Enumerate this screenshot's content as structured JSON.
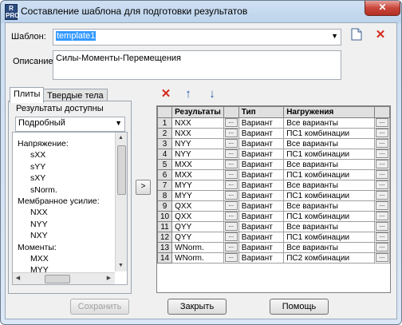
{
  "window": {
    "app_icon_text": "R PRO",
    "title": "Составление шаблона для подготовки результатов",
    "close_glyph": "✕"
  },
  "template": {
    "label": "Шаблон:",
    "value": "template1"
  },
  "description": {
    "label": "Описание:",
    "value": "Силы-Моменты-Перемещения"
  },
  "tabs": [
    {
      "label": "Плиты"
    },
    {
      "label": "Твердые тела"
    }
  ],
  "left_panel": {
    "available_label": "Результаты доступны",
    "detail_mode": "Подробный",
    "tree": [
      {
        "text": "Напряжение:",
        "level": 0
      },
      {
        "text": "sXX",
        "level": 1
      },
      {
        "text": "sYY",
        "level": 1
      },
      {
        "text": "sXY",
        "level": 1
      },
      {
        "text": "sNorm.",
        "level": 1
      },
      {
        "text": "Мембранное усилие:",
        "level": 0
      },
      {
        "text": "NXX",
        "level": 1
      },
      {
        "text": "NYY",
        "level": 1
      },
      {
        "text": "NXY",
        "level": 1
      },
      {
        "text": "Моменты:",
        "level": 0
      },
      {
        "text": "MXX",
        "level": 1
      },
      {
        "text": "MYY",
        "level": 1
      }
    ]
  },
  "move_button": ">",
  "toolbar": {
    "delete_glyph": "✕",
    "up_glyph": "↑",
    "down_glyph": "↓"
  },
  "grid": {
    "headers": [
      "",
      "Результаты",
      "",
      "Тип",
      "Нагружения",
      ""
    ],
    "dot_glyph": "...",
    "rows": [
      {
        "n": "1",
        "result": "NXX",
        "type": "Вариант",
        "load": "Все варианты"
      },
      {
        "n": "2",
        "result": "NXX",
        "type": "Вариант",
        "load": "ПС1 комбинации"
      },
      {
        "n": "3",
        "result": "NYY",
        "type": "Вариант",
        "load": "Все варианты"
      },
      {
        "n": "4",
        "result": "NYY",
        "type": "Вариант",
        "load": "ПС1 комбинации"
      },
      {
        "n": "5",
        "result": "MXX",
        "type": "Вариант",
        "load": "Все варианты"
      },
      {
        "n": "6",
        "result": "MXX",
        "type": "Вариант",
        "load": "ПС1 комбинации"
      },
      {
        "n": "7",
        "result": "MYY",
        "type": "Вариант",
        "load": "Все варианты"
      },
      {
        "n": "8",
        "result": "MYY",
        "type": "Вариант",
        "load": "ПС1 комбинации"
      },
      {
        "n": "9",
        "result": "QXX",
        "type": "Вариант",
        "load": "Все варианты"
      },
      {
        "n": "10",
        "result": "QXX",
        "type": "Вариант",
        "load": "ПС1 комбинации"
      },
      {
        "n": "11",
        "result": "QYY",
        "type": "Вариант",
        "load": "Все варианты"
      },
      {
        "n": "12",
        "result": "QYY",
        "type": "Вариант",
        "load": "ПС1 комбинации"
      },
      {
        "n": "13",
        "result": "WNorm.",
        "type": "Вариант",
        "load": "Все варианты"
      },
      {
        "n": "14",
        "result": "WNorm.",
        "type": "Вариант",
        "load": "ПС2 комбинации"
      }
    ]
  },
  "buttons": {
    "save": "Сохранить",
    "close": "Закрыть",
    "help": "Помощь"
  }
}
